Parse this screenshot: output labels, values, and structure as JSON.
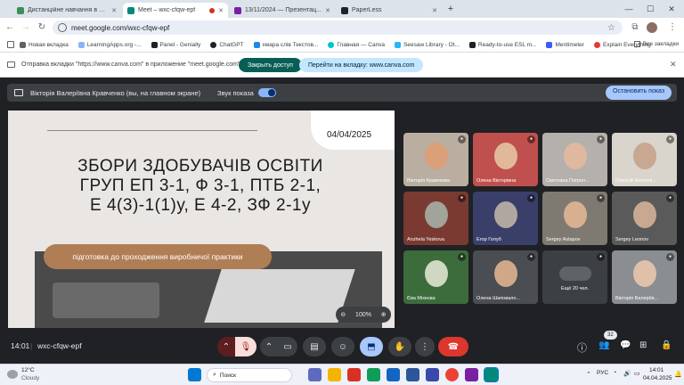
{
  "tabs": [
    {
      "title": "Дистанційне навчання в ВСП ...",
      "fav_color": "#3c8e5c",
      "active": false
    },
    {
      "title": "Meet – wxc-cfqw-epf",
      "fav_color": "#00897b",
      "active": true
    },
    {
      "title": "13/11/2024 — Презентац...",
      "fav_color": "#7b1fa2",
      "active": false
    },
    {
      "title": "PaperLess",
      "fav_color": "#202124",
      "active": false
    }
  ],
  "new_tab_glyph": "+",
  "window": {
    "minimize": "—",
    "maximize": "☐",
    "close": "✕"
  },
  "address": {
    "url": "meet.google.com/wxc-cfqw-epf"
  },
  "bookmarks": [
    {
      "label": "Новая вкладка",
      "color": "#5f6368"
    },
    {
      "label": "LearningApps.org -...",
      "color": "#8ab4f8"
    },
    {
      "label": "Panel - Genially",
      "color": "#202124"
    },
    {
      "label": "ChatGPT",
      "color": "#202124"
    },
    {
      "label": "хмара слів Текстов...",
      "color": "#1e88e5"
    },
    {
      "label": "Главная — Canva",
      "color": "#00c4cc"
    },
    {
      "label": "Seesaw Library - Ot...",
      "color": "#29b6f6"
    },
    {
      "label": "Ready-to-use ESL m...",
      "color": "#202124"
    },
    {
      "label": "Mentimeter",
      "color": "#3d5afe"
    },
    {
      "label": "Explain Everything",
      "color": "#e53935"
    }
  ],
  "all_bookmarks": "Все закладки",
  "infobar": {
    "message": "Отправка вкладки \"https://www.canva.com\" в приложение \"meet.google.com\".",
    "close_access": "Закрыть доступ",
    "go_to_tab": "Перейти на вкладку: www.canva.com"
  },
  "presenting": {
    "presenter": "Вікторія Валеріївна Кравченко (вы, на главном экране)",
    "sound_label": "Звук показа",
    "stop_button": "Остановить показ"
  },
  "slide": {
    "date": "04/04/2025",
    "title_lines": [
      "ЗБОРИ ЗДОБУВАЧІВ ОСВІТИ",
      "ГРУП ЕП 3-1, Ф 3-1, ПТБ 2-1,",
      "Е 4(3)-1(1)у, Е 4-2, ЗФ 2-1у"
    ],
    "subtitle": "підготовка до проходження виробничої практики",
    "zoom": "100%"
  },
  "participants": [
    {
      "name": "Вікторія Кравчкова",
      "bg": "#b9aea0",
      "face": "#d9a07a"
    },
    {
      "name": "Олена Вікторівна",
      "bg": "#c0504d",
      "face": "#e2b89a"
    },
    {
      "name": "Светлана Погрон...",
      "bg": "#b4b0ac",
      "face": "#e0b8a0"
    },
    {
      "name": "Олексій Анатолі...",
      "bg": "#d9d4cc",
      "face": "#c8a890"
    },
    {
      "name": "Anzhela Yeskova",
      "bg": "#7a3a32",
      "face": "#a0a49a"
    },
    {
      "name": "Егор Голуб",
      "bg": "#3a3f6a",
      "face": "#b0a8a0"
    },
    {
      "name": "Sergey Astapov",
      "bg": "#7e7a72",
      "face": "#d8b090"
    },
    {
      "name": "Sergey Leonov",
      "bg": "#5a5a5a",
      "face": "#c8a890"
    },
    {
      "name": "Єва Міхеєва",
      "bg": "#3c6b3c",
      "face": "#cfd8c0"
    },
    {
      "name": "Олена Шаповало...",
      "bg": "#4a4d52",
      "face": "#d0a888"
    },
    {
      "name": "Ещё 20 чел.",
      "bg": "#3c4043",
      "face": ""
    },
    {
      "name": "Вікторія Валеріїв...",
      "bg": "#8a8e92",
      "face": "#e0c0a8"
    }
  ],
  "meeting": {
    "time": "14:01",
    "code": "wxc-cfqw-epf",
    "people_count": "32"
  },
  "taskbar": {
    "temp": "12°C",
    "weather": "Cloudy",
    "search": "Поиск",
    "lang": "РУС",
    "clock_time": "14:01",
    "clock_date": "04.04.2025"
  }
}
